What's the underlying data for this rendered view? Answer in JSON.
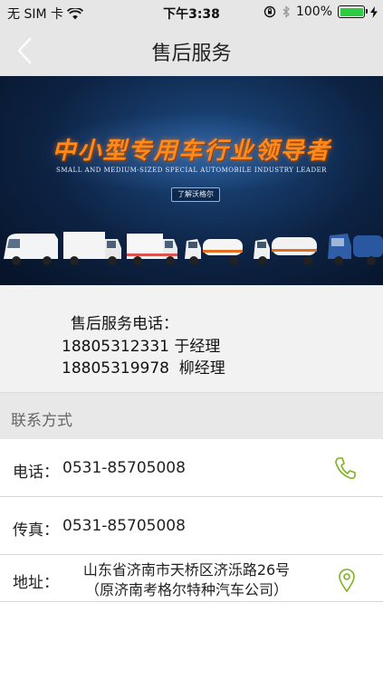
{
  "status_bar": {
    "carrier": "无 SIM 卡",
    "wifi_icon": "wifi-icon",
    "time": "下午3:38",
    "battery_percent": "100%",
    "battery_level": 1.0,
    "battery_color": "#2ecc40"
  },
  "navbar": {
    "title": "售后服务",
    "back_icon": "chevron-left-icon"
  },
  "banner": {
    "headline": "中小型专用车行业领导者",
    "subline": "SMALL AND MEDIUM-SIZED SPECIAL AUTOMOBILE INDUSTRY LEADER",
    "button_label": "了解沃格尔"
  },
  "hotline": {
    "label": "售后服务电话：",
    "lines": [
      "18805312331 于经理",
      "18805319978  柳经理"
    ]
  },
  "contact": {
    "header": "联系方式",
    "phone": {
      "label": "电话：",
      "value": "0531-85705008",
      "icon": "phone-icon"
    },
    "fax": {
      "label": "传真：",
      "value": "0531-85705008"
    },
    "address": {
      "label": "地址：",
      "line1": "山东省济南市天桥区济泺路26号",
      "line2": "（原济南考格尔特种汽车公司）",
      "icon": "location-pin-icon"
    }
  },
  "colors": {
    "accent_green": "#7ab51d",
    "bar_grey": "#e6e6e6",
    "headline_orange": "#ff8a1a"
  }
}
